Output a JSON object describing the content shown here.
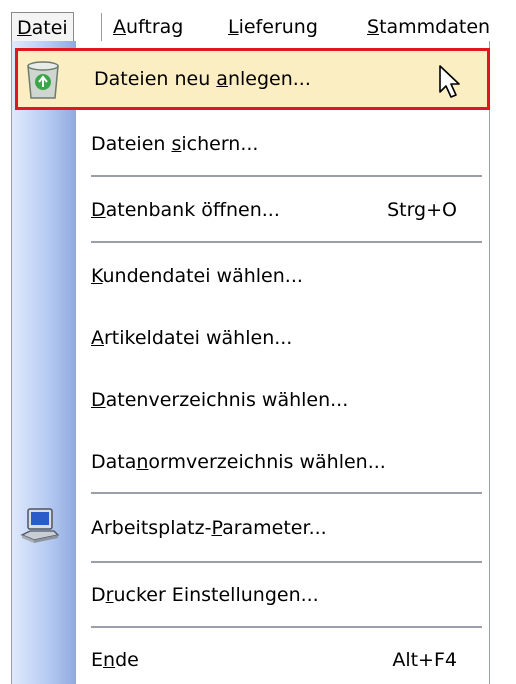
{
  "menubar": {
    "items": [
      {
        "pre": "",
        "u": "D",
        "post": "atei"
      },
      {
        "pre": "",
        "u": "A",
        "post": "uftrag"
      },
      {
        "pre": "",
        "u": "L",
        "post": "ieferung"
      },
      {
        "pre": "",
        "u": "S",
        "post": "tammdaten"
      }
    ]
  },
  "menu": {
    "items": [
      {
        "pre": "Dateien neu ",
        "u": "a",
        "post": "nlegen...",
        "shortcut": "",
        "icon": "recycle-bin-icon"
      },
      {
        "pre": "Dateien ",
        "u": "s",
        "post": "ichern...",
        "shortcut": ""
      },
      {
        "pre": "",
        "u": "D",
        "post": "atenbank öffnen...",
        "shortcut": "Strg+O"
      },
      {
        "pre": "",
        "u": "K",
        "post": "undendatei wählen...",
        "shortcut": ""
      },
      {
        "pre": "",
        "u": "A",
        "post": "rtikeldatei wählen...",
        "shortcut": ""
      },
      {
        "pre": "",
        "u": "D",
        "post": "atenverzeichnis wählen...",
        "shortcut": ""
      },
      {
        "pre": "Data",
        "u": "n",
        "post": "ormverzeichnis wählen...",
        "shortcut": ""
      },
      {
        "pre": "Arbeitsplatz-",
        "u": "P",
        "post": "arameter...",
        "shortcut": "",
        "icon": "computer-icon"
      },
      {
        "pre": "D",
        "u": "r",
        "post": "ucker Einstellungen...",
        "shortcut": ""
      },
      {
        "pre": "E",
        "u": "n",
        "post": "de",
        "shortcut": "Alt+F4"
      }
    ]
  },
  "colors": {
    "highlight_bg": "#fbeec2",
    "highlight_border": "#e0171c",
    "gutter": "#b7ccf3"
  }
}
